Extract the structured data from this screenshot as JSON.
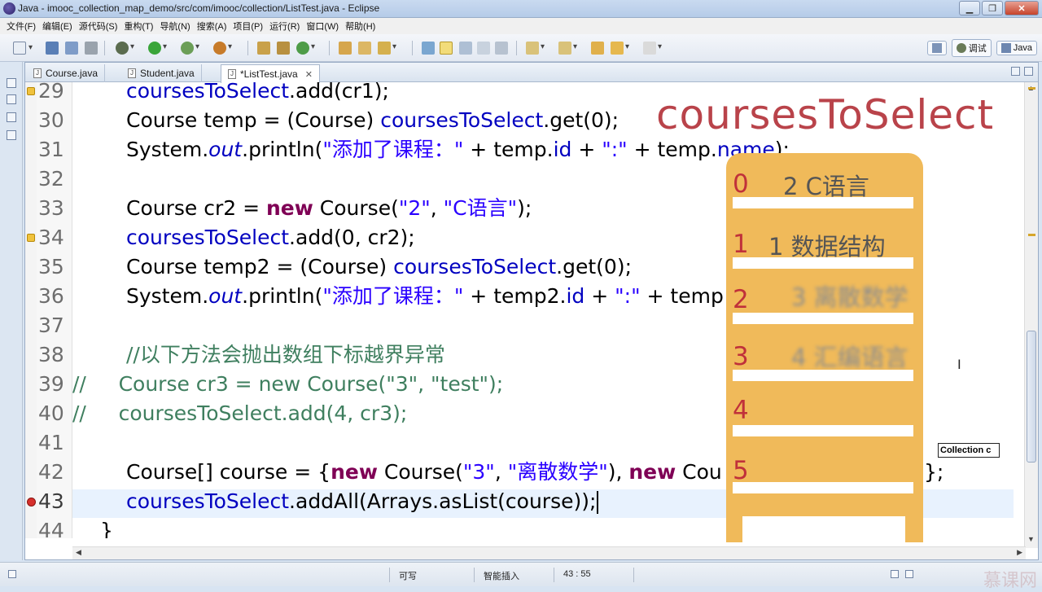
{
  "window": {
    "title": "Java - imooc_collection_map_demo/src/com/imooc/collection/ListTest.java - Eclipse",
    "buttons": [
      "▁",
      "❐",
      "✕"
    ]
  },
  "menu": [
    "文件(F)",
    "编辑(E)",
    "源代码(S)",
    "重构(T)",
    "导航(N)",
    "搜索(A)",
    "项目(P)",
    "运行(R)",
    "窗口(W)",
    "帮助(H)"
  ],
  "perspective": {
    "debug_label": "调试",
    "java_label": "Java"
  },
  "tabs": [
    {
      "label": "Course.java"
    },
    {
      "label": "Student.java"
    },
    {
      "label": "*ListTest.java",
      "close": "✕"
    }
  ],
  "line_numbers": [
    "29",
    "30",
    "31",
    "32",
    "33",
    "34",
    "35",
    "36",
    "37",
    "38",
    "39",
    "40",
    "41",
    "42",
    "43",
    "44"
  ],
  "code": {
    "l29": {
      "a": "coursesToSelect",
      "b": ".add(cr1);"
    },
    "l30": {
      "a": "Course temp = (Course) ",
      "b": "coursesToSelect",
      "c": ".get(0);"
    },
    "l31": {
      "a": "System.",
      "b": "out",
      "c": ".println(",
      "d": "\"添加了课程：\"",
      "e": " + temp.",
      "f": "id",
      "g": " + ",
      "h": "\":\"",
      "i": " + temp.",
      "j": "name",
      "k": ");"
    },
    "l33": {
      "a": "Course cr2 = ",
      "b": "new",
      "c": " Course(",
      "d": "\"2\"",
      "e": ", ",
      "f": "\"C语言\"",
      "g": ");"
    },
    "l34": {
      "a": "coursesToSelect",
      "b": ".add(0, cr2);"
    },
    "l35": {
      "a": "Course temp2 = (Course) ",
      "b": "coursesToSelect",
      "c": ".get(0);"
    },
    "l36": {
      "a": "System.",
      "b": "out",
      "c": ".println(",
      "d": "\"添加了课程：\"",
      "e": " + temp2.",
      "f": "id",
      "g": " + ",
      "h": "\":\"",
      "i": " + temp"
    },
    "l38": "//以下方法会抛出数组下标越界异常",
    "l39": "//     Course cr3 = new Course(\"3\", \"test\");",
    "l40": "//     coursesToSelect.add(4, cr3);",
    "l42": {
      "a": "Course[] course = {",
      "b": "new",
      "c": " Course(",
      "d": "\"3\"",
      "e": ", ",
      "f": "\"离散数学\"",
      "g": "), ",
      "h": "new",
      "i": " Cou",
      "j": "};"
    },
    "l43": {
      "a": "coursesToSelect",
      "b": ".addAll(Arrays.asList(course));"
    },
    "l44": "}"
  },
  "overlay": {
    "title": "coursesToSelect",
    "slots": [
      {
        "index": "0",
        "value": "2  C语言"
      },
      {
        "index": "1",
        "value": "1  数据结构"
      },
      {
        "index": "2",
        "value": "3  离散数学"
      },
      {
        "index": "3",
        "value": "4  汇编语言"
      },
      {
        "index": "4",
        "value": ""
      },
      {
        "index": "5",
        "value": ""
      }
    ]
  },
  "tooltip": "Collection c",
  "status": {
    "writable": "可写",
    "insert_mode": "智能插入",
    "position": "43 : 55"
  },
  "watermark": "慕课网",
  "colors": {
    "keyword": "#7f0055",
    "field": "#0000c0",
    "string": "#2a00ff",
    "comment": "#3f7f5f",
    "overlay_title": "#b9434a",
    "list_fill": "#f0ba5a",
    "index_red": "#c0313a"
  }
}
